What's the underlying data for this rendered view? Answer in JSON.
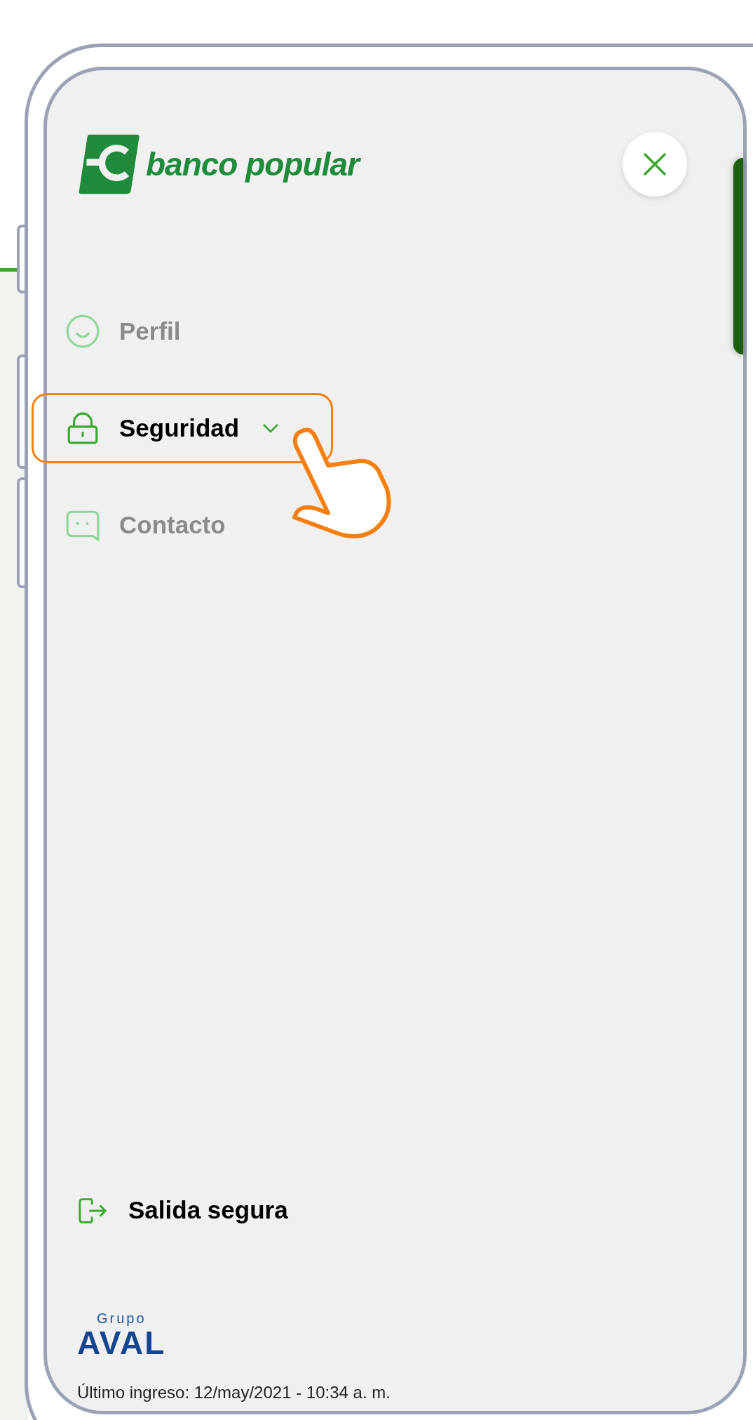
{
  "logo": {
    "text": "banco popular"
  },
  "menu": {
    "items": [
      {
        "label": "Perfil",
        "selected": false,
        "highlighted": false,
        "has_submenu": false
      },
      {
        "label": "Seguridad",
        "selected": true,
        "highlighted": true,
        "has_submenu": true
      },
      {
        "label": "Contacto",
        "selected": false,
        "highlighted": false,
        "has_submenu": false
      }
    ]
  },
  "logout": {
    "label": "Salida segura"
  },
  "footer": {
    "group_logo": {
      "prefix": "Grupo",
      "name": "AVAL"
    },
    "last_login": "Último ingreso: 12/may/2021 - 10:34 a. m."
  }
}
